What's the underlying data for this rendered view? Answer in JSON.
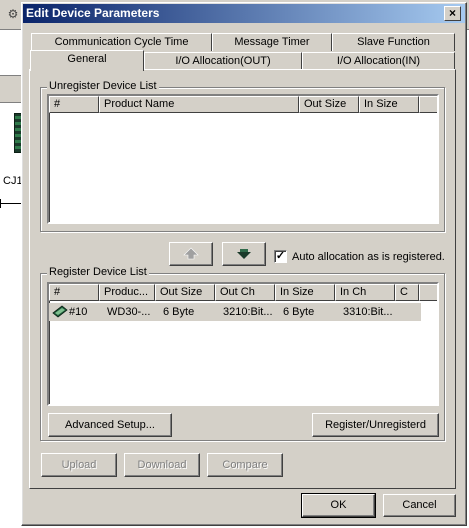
{
  "background": {
    "label": "CJ1",
    "toolbar_icon": "gear-icon"
  },
  "dialog": {
    "title": "Edit Device Parameters",
    "close_label": "×"
  },
  "tabs": {
    "row1": [
      {
        "label": "Communication Cycle Time"
      },
      {
        "label": "Message Timer"
      },
      {
        "label": "Slave Function"
      }
    ],
    "row2": [
      {
        "label": "General",
        "active": true
      },
      {
        "label": "I/O Allocation(OUT)"
      },
      {
        "label": "I/O Allocation(IN)"
      }
    ]
  },
  "unregister": {
    "group_label": "Unregister Device List",
    "columns": [
      "#",
      "Product Name",
      "Out Size",
      "In Size"
    ]
  },
  "move_buttons": {
    "up_icon": "arrow-up-icon",
    "down_icon": "arrow-down-icon"
  },
  "auto_alloc": {
    "label": "Auto allocation as is registered.",
    "checked": true,
    "mark": "✓"
  },
  "register": {
    "group_label": "Register Device List",
    "columns": [
      "#",
      "Produc...",
      "Out Size",
      "Out Ch",
      "In Size",
      "In Ch",
      "C"
    ],
    "rows": [
      [
        "#10",
        "WD30-...",
        "6 Byte",
        "3210:Bit...",
        "6 Byte",
        "3310:Bit...",
        ""
      ]
    ],
    "advanced_label": "Advanced Setup...",
    "register_label": "Register/Unregisterd"
  },
  "bottom": {
    "upload_label": "Upload",
    "download_label": "Download",
    "compare_label": "Compare",
    "ok_label": "OK",
    "cancel_label": "Cancel"
  }
}
